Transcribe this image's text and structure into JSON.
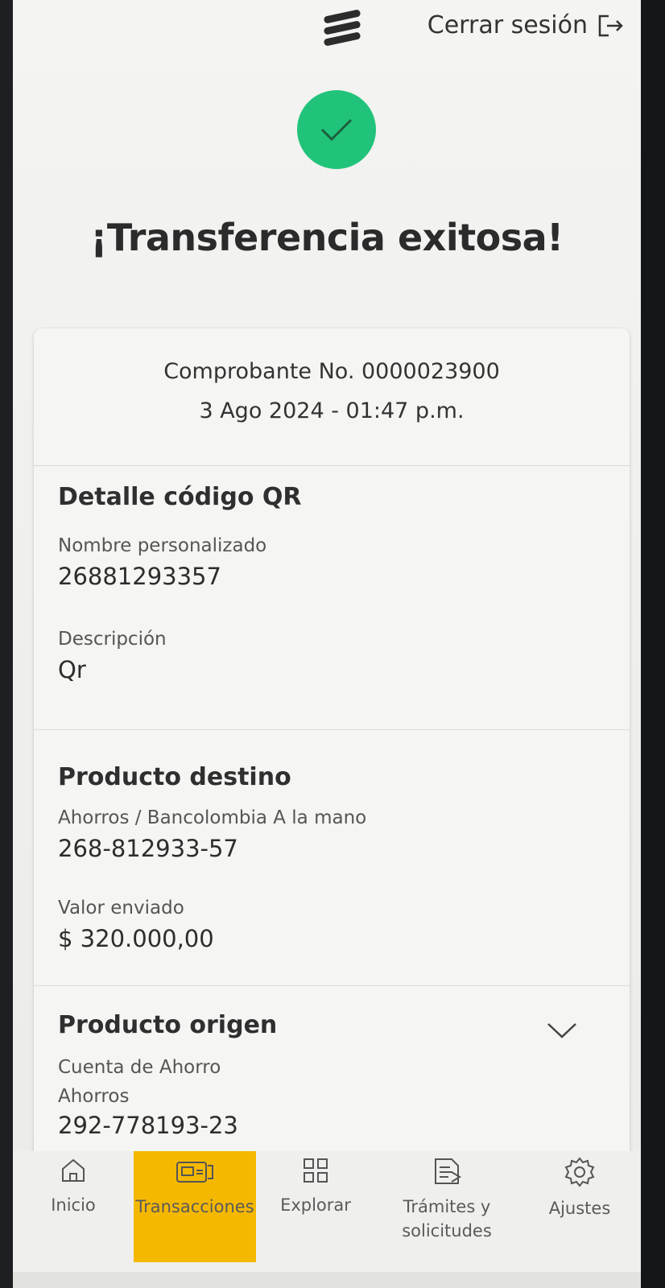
{
  "header": {
    "logout_label": "Cerrar sesión",
    "logo_icon": "bancolombia-logo-icon",
    "logout_icon": "logout-arrow-icon"
  },
  "status": {
    "icon": "check-icon",
    "title": "¡Transferencia exitosa!",
    "accent_color": "#21c37a"
  },
  "receipt": {
    "number": "Comprobante No. 0000023900",
    "datetime": "3 Ago 2024 - 01:47 p.m."
  },
  "qr_detail": {
    "title": "Detalle código QR",
    "custom_name_label": "Nombre personalizado",
    "custom_name_value": "26881293357",
    "description_label": "Descripción",
    "description_value": "Qr"
  },
  "destination": {
    "title": "Producto destino",
    "account_type": "Ahorros / Bancolombia A la mano",
    "account_number": "268-812933-57",
    "amount_label": "Valor enviado",
    "amount_value": "$ 320.000,00"
  },
  "origin": {
    "title": "Producto origen",
    "account_name": "Cuenta de Ahorro",
    "account_type": "Ahorros",
    "account_number": "292-778193-23",
    "expand_icon": "chevron-down-icon"
  },
  "nav": {
    "items": [
      {
        "label": "Inicio",
        "icon": "home-icon"
      },
      {
        "label": "Transacciones",
        "icon": "transactions-icon",
        "active": true
      },
      {
        "label": "Explorar",
        "icon": "grid-icon"
      },
      {
        "label": "Trámites y solicitudes",
        "icon": "document-icon"
      },
      {
        "label": "Ajustes",
        "icon": "gear-icon"
      }
    ],
    "active_color": "#f5b800"
  }
}
